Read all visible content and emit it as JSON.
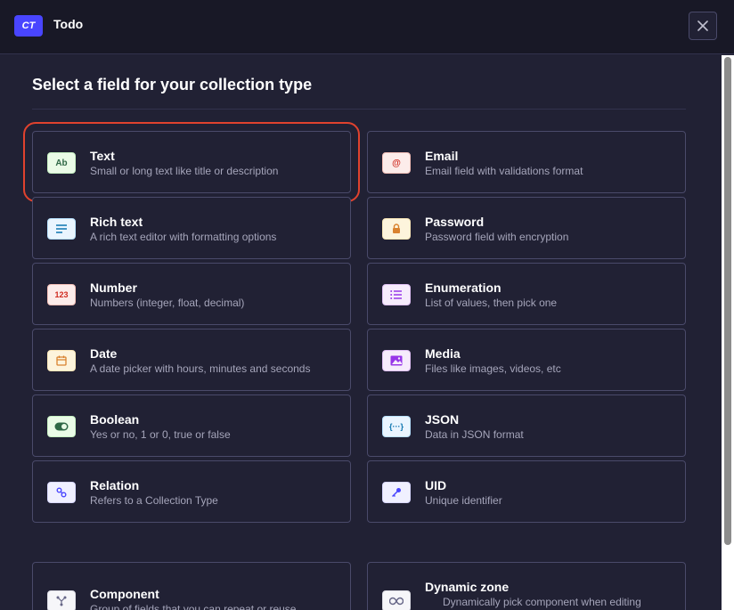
{
  "header": {
    "badge": "CT",
    "title": "Todo"
  },
  "section_title": "Select a field for your collection type",
  "fields": [
    {
      "title": "Text",
      "desc": "Small or long text like title or description",
      "icon": "text-icon",
      "icon_glyph": "Ab"
    },
    {
      "title": "Email",
      "desc": "Email field with validations format",
      "icon": "email-icon",
      "icon_glyph": "@"
    },
    {
      "title": "Rich text",
      "desc": "A rich text editor with formatting options",
      "icon": "richtext-icon",
      "icon_glyph": ""
    },
    {
      "title": "Password",
      "desc": "Password field with encryption",
      "icon": "lock-icon",
      "icon_glyph": ""
    },
    {
      "title": "Number",
      "desc": "Numbers (integer, float, decimal)",
      "icon": "number-icon",
      "icon_glyph": "123"
    },
    {
      "title": "Enumeration",
      "desc": "List of values, then pick one",
      "icon": "list-icon",
      "icon_glyph": ""
    },
    {
      "title": "Date",
      "desc": "A date picker with hours, minutes and seconds",
      "icon": "calendar-icon",
      "icon_glyph": ""
    },
    {
      "title": "Media",
      "desc": "Files like images, videos, etc",
      "icon": "image-icon",
      "icon_glyph": ""
    },
    {
      "title": "Boolean",
      "desc": "Yes or no, 1 or 0, true or false",
      "icon": "toggle-icon",
      "icon_glyph": ""
    },
    {
      "title": "JSON",
      "desc": "Data in JSON format",
      "icon": "json-icon",
      "icon_glyph": "{···}"
    },
    {
      "title": "Relation",
      "desc": "Refers to a Collection Type",
      "icon": "relation-icon",
      "icon_glyph": ""
    },
    {
      "title": "UID",
      "desc": "Unique identifier",
      "icon": "key-icon",
      "icon_glyph": ""
    }
  ],
  "extra_fields": [
    {
      "title": "Component",
      "desc": "Group of fields that you can repeat or reuse",
      "icon": "component-icon"
    },
    {
      "title": "Dynamic zone",
      "desc": "Dynamically pick component when editing",
      "icon": "infinity-icon"
    }
  ],
  "colors": {
    "accent": "#4945ff",
    "highlight": "#e0422e",
    "background": "#212134"
  }
}
